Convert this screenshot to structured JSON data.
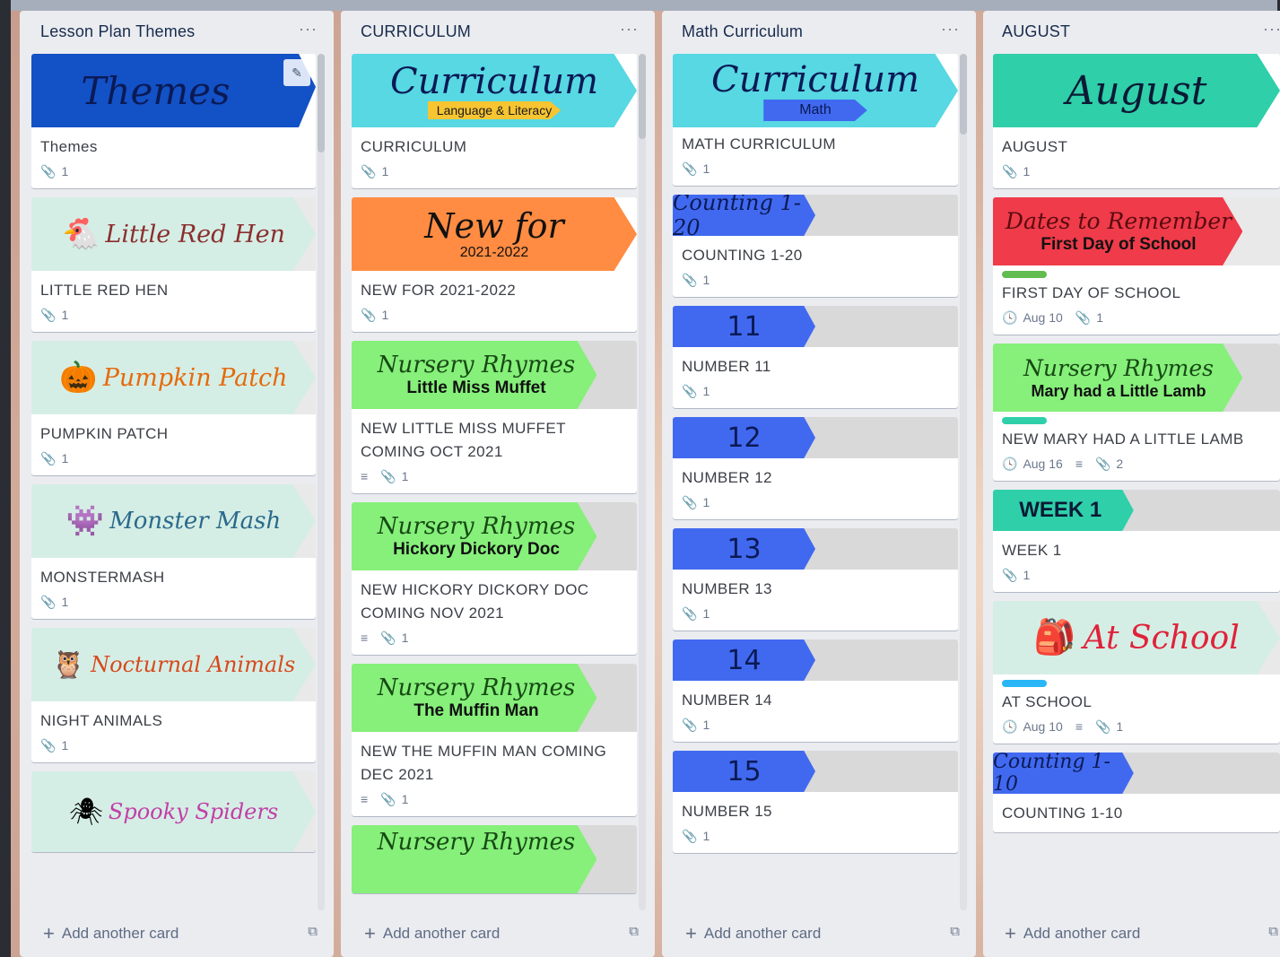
{
  "lists": [
    {
      "title": "Lesson Plan Themes",
      "menu": "···",
      "add_card": "Add another card",
      "cards": [
        {
          "banner": "Themes",
          "title": "Themes",
          "attachments": "1",
          "cover_color": "#1351c6"
        },
        {
          "banner": "Little Red Hen",
          "title": "LITTLE RED HEN",
          "attachments": "1",
          "cover_color": "#d5eee5"
        },
        {
          "banner": "Pumpkin Patch",
          "title": "PUMPKIN PATCH",
          "attachments": "1",
          "cover_color": "#d5eee5"
        },
        {
          "banner": "Monster Mash",
          "title": "MONSTERMASH",
          "attachments": "1",
          "cover_color": "#d5eee5"
        },
        {
          "banner": "Nocturnal Animals",
          "title": "NIGHT ANIMALS",
          "attachments": "1",
          "cover_color": "#d5eee5"
        },
        {
          "banner": "Spooky Spiders",
          "cover_color": "#d5eee5"
        }
      ]
    },
    {
      "title": "CURRICULUM",
      "menu": "···",
      "add_card": "Add another card",
      "cards": [
        {
          "banner": "Curriculum",
          "banner_sub": "Language & Literacy",
          "title": "CURRICULUM",
          "attachments": "1",
          "cover_color": "#57d8e3"
        },
        {
          "banner": "New for",
          "banner_sub": "2021-2022",
          "title": "NEW FOR 2021-2022",
          "attachments": "1",
          "cover_color": "#ff8c42"
        },
        {
          "banner": "Nursery Rhymes",
          "banner_sub": "Little Miss Muffet",
          "title": "NEW LITTLE MISS MUFFET COMING OCT 2021",
          "attachments": "1",
          "cover_color": "#86f07a"
        },
        {
          "banner": "Nursery Rhymes",
          "banner_sub": "Hickory Dickory Doc",
          "title": "NEW HICKORY DICKORY DOC COMING NOV 2021",
          "attachments": "1",
          "cover_color": "#86f07a"
        },
        {
          "banner": "Nursery Rhymes",
          "banner_sub": "The Muffin Man",
          "title": "NEW THE MUFFIN MAN COMING DEC 2021",
          "attachments": "1",
          "cover_color": "#86f07a"
        },
        {
          "banner": "Nursery Rhymes",
          "cover_color": "#86f07a"
        }
      ]
    },
    {
      "title": "Math Curriculum",
      "menu": "···",
      "add_card": "Add another card",
      "cards": [
        {
          "banner": "Curriculum",
          "banner_sub": "Math",
          "title": "MATH CURRICULUM",
          "attachments": "1",
          "cover_color": "#57d8e3"
        },
        {
          "banner": "Counting 1-20",
          "title": "COUNTING 1-20",
          "attachments": "1",
          "cover_color": "#4169f0"
        },
        {
          "banner": "11",
          "title": "NUMBER 11",
          "attachments": "1",
          "cover_color": "#4169f0"
        },
        {
          "banner": "12",
          "title": "NUMBER 12",
          "attachments": "1",
          "cover_color": "#4169f0"
        },
        {
          "banner": "13",
          "title": "NUMBER 13",
          "attachments": "1",
          "cover_color": "#4169f0"
        },
        {
          "banner": "14",
          "title": "NUMBER 14",
          "attachments": "1",
          "cover_color": "#4169f0"
        },
        {
          "banner": "15",
          "title": "NUMBER 15",
          "attachments": "1",
          "cover_color": "#4169f0"
        }
      ]
    },
    {
      "title": "AUGUST",
      "menu": "···",
      "add_card": "Add another card",
      "cards": [
        {
          "banner": "August",
          "title": "AUGUST",
          "attachments": "1",
          "cover_color": "#2fcfa9"
        },
        {
          "banner": "Dates to Remember",
          "banner_sub": "First Day of School",
          "title": "FIRST DAY OF SCHOOL",
          "due": "Aug 10",
          "attachments": "1",
          "cover_color": "#ef3b4a",
          "label_color": "#61bd4f"
        },
        {
          "banner": "Nursery Rhymes",
          "banner_sub": "Mary had a Little Lamb",
          "title": "NEW MARY HAD A LITTLE LAMB",
          "due": "Aug 16",
          "attachments": "2",
          "cover_color": "#86f07a",
          "label_color": "#2fcfa9"
        },
        {
          "banner": "WEEK 1",
          "title": "WEEK 1",
          "attachments": "1",
          "cover_color": "#2fcfa9"
        },
        {
          "banner": "At School",
          "title": "AT SCHOOL",
          "due": "Aug 10",
          "attachments": "1",
          "cover_color": "#d5eee5",
          "label_color": "#29b6f6"
        },
        {
          "banner": "Counting 1-10",
          "title": "COUNTING 1-10",
          "cover_color": "#4169f0"
        }
      ]
    }
  ]
}
